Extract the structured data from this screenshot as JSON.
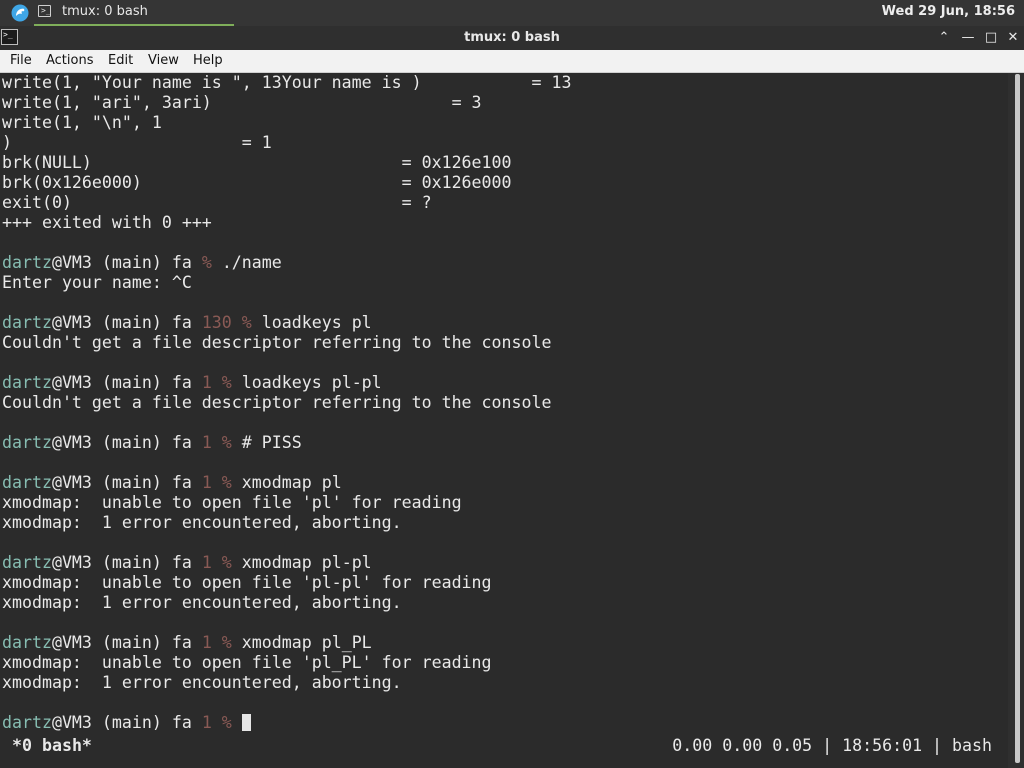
{
  "panel": {
    "logo_icon": "desktop-logo-icon",
    "task_label": "tmux: 0 bash",
    "task_icon_glyph": ">_",
    "clock": "Wed 29 Jun, 18:56"
  },
  "window": {
    "title": "tmux: 0 bash",
    "icon_glyph": ">_",
    "buttons": {
      "up": "⌃",
      "minimize": "—",
      "maximize": "□",
      "close": "✕"
    }
  },
  "menu": [
    "File",
    "Actions",
    "Edit",
    "View",
    "Help"
  ],
  "colors": {
    "prompt_user": "#87bdb2",
    "prompt_status": "#8a5a55",
    "accent": "#7fae5a"
  },
  "terminal": {
    "lines": [
      {
        "text": "write(1, \"Your name is \", 13Your name is )           = 13"
      },
      {
        "text": "write(1, \"ari\", 3ari)                        = 3"
      },
      {
        "text": "write(1, \"\\n\", 1"
      },
      {
        "text": ")                       = 1"
      },
      {
        "text": "brk(NULL)                               = 0x126e100"
      },
      {
        "text": "brk(0x126e000)                          = 0x126e000"
      },
      {
        "text": "exit(0)                                 = ?"
      },
      {
        "text": "+++ exited with 0 +++"
      },
      {
        "text": ""
      },
      {
        "prompt": {
          "user": "dartz",
          "rest": "@VM3 (main) fa",
          "status": "",
          "pct": " % ",
          "cmd": "./name"
        }
      },
      {
        "text": "Enter your name: ^C"
      },
      {
        "text": ""
      },
      {
        "prompt": {
          "user": "dartz",
          "rest": "@VM3 (main) fa ",
          "status": "130",
          "pct": " % ",
          "cmd": "loadkeys pl"
        }
      },
      {
        "text": "Couldn't get a file descriptor referring to the console"
      },
      {
        "text": ""
      },
      {
        "prompt": {
          "user": "dartz",
          "rest": "@VM3 (main) fa ",
          "status": "1",
          "pct": " % ",
          "cmd": "loadkeys pl-pl"
        }
      },
      {
        "text": "Couldn't get a file descriptor referring to the console"
      },
      {
        "text": ""
      },
      {
        "prompt": {
          "user": "dartz",
          "rest": "@VM3 (main) fa ",
          "status": "1",
          "pct": " % ",
          "cmd": "# PISS"
        }
      },
      {
        "text": ""
      },
      {
        "prompt": {
          "user": "dartz",
          "rest": "@VM3 (main) fa ",
          "status": "1",
          "pct": " % ",
          "cmd": "xmodmap pl"
        }
      },
      {
        "text": "xmodmap:  unable to open file 'pl' for reading"
      },
      {
        "text": "xmodmap:  1 error encountered, aborting."
      },
      {
        "text": ""
      },
      {
        "prompt": {
          "user": "dartz",
          "rest": "@VM3 (main) fa ",
          "status": "1",
          "pct": " % ",
          "cmd": "xmodmap pl-pl"
        }
      },
      {
        "text": "xmodmap:  unable to open file 'pl-pl' for reading"
      },
      {
        "text": "xmodmap:  1 error encountered, aborting."
      },
      {
        "text": ""
      },
      {
        "prompt": {
          "user": "dartz",
          "rest": "@VM3 (main) fa ",
          "status": "1",
          "pct": " % ",
          "cmd": "xmodmap pl_PL"
        }
      },
      {
        "text": "xmodmap:  unable to open file 'pl_PL' for reading"
      },
      {
        "text": "xmodmap:  1 error encountered, aborting."
      },
      {
        "text": ""
      },
      {
        "prompt": {
          "user": "dartz",
          "rest": "@VM3 (main) fa ",
          "status": "1",
          "pct": " % ",
          "cmd": ""
        },
        "cursor": true
      }
    ],
    "status_left": "*0 bash*",
    "status_right": "0.00 0.00 0.05 | 18:56:01 | bash"
  }
}
